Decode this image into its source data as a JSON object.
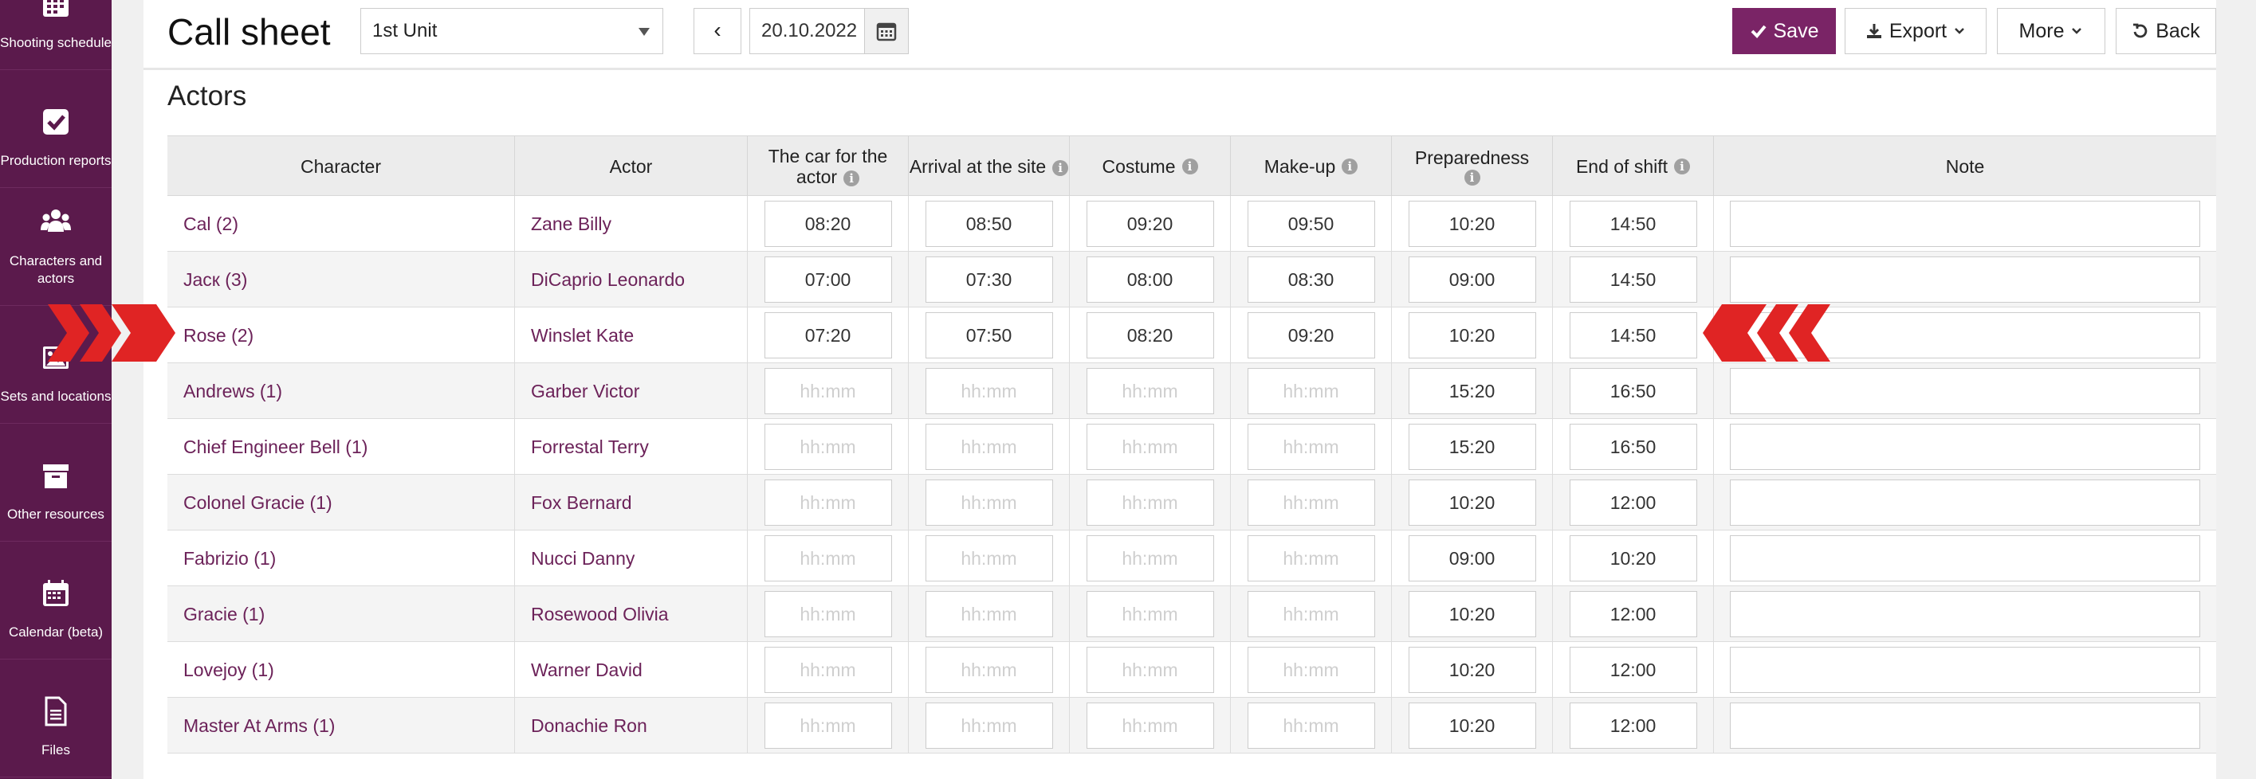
{
  "sidebar": {
    "items": [
      {
        "label": "Shooting schedule",
        "icon": "calendar-grid-icon"
      },
      {
        "label": "Production reports",
        "icon": "checkbox-icon"
      },
      {
        "label": "Characters and actors",
        "icon": "users-icon"
      },
      {
        "label": "Sets and locations",
        "icon": "image-icon"
      },
      {
        "label": "Other resources",
        "icon": "archive-box-icon"
      },
      {
        "label": "Calendar (beta)",
        "icon": "calendar-icon"
      },
      {
        "label": "Files",
        "icon": "file-icon"
      }
    ]
  },
  "header": {
    "title": "Call sheet",
    "unit_select": "1st Unit",
    "prev_label": "‹",
    "date": "20.10.2022",
    "save_label": "Save",
    "export_label": "Export",
    "more_label": "More",
    "back_label": "Back"
  },
  "section": {
    "title": "Actors"
  },
  "table": {
    "headers": {
      "character": "Character",
      "actor": "Actor",
      "car": "The car for the actor",
      "arrival": "Arrival at the site",
      "costume": "Costume",
      "makeup": "Make-up",
      "preparedness": "Preparedness",
      "end": "End of shift",
      "note": "Note"
    },
    "placeholder": "hh:mm",
    "rows": [
      {
        "character": "Cal (2)",
        "actor": "Zane Billy",
        "car": "08:20",
        "arrival": "08:50",
        "costume": "09:20",
        "makeup": "09:50",
        "preparedness": "10:20",
        "end": "14:50"
      },
      {
        "character": "Jacк (3)",
        "actor": "DiCaprio Leonardo",
        "car": "07:00",
        "arrival": "07:30",
        "costume": "08:00",
        "makeup": "08:30",
        "preparedness": "09:00",
        "end": "14:50"
      },
      {
        "character": "Rose (2)",
        "actor": "Winslet Kate",
        "car": "07:20",
        "arrival": "07:50",
        "costume": "08:20",
        "makeup": "09:20",
        "preparedness": "10:20",
        "end": "14:50"
      },
      {
        "character": "Andrews (1)",
        "actor": "Garber Victor",
        "car": "",
        "arrival": "",
        "costume": "",
        "makeup": "",
        "preparedness": "15:20",
        "end": "16:50"
      },
      {
        "character": "Chief Engineer Bell (1)",
        "actor": "Forrestal Terry",
        "car": "",
        "arrival": "",
        "costume": "",
        "makeup": "",
        "preparedness": "15:20",
        "end": "16:50"
      },
      {
        "character": "Colonel Gracie (1)",
        "actor": "Fox Bernard",
        "car": "",
        "arrival": "",
        "costume": "",
        "makeup": "",
        "preparedness": "10:20",
        "end": "12:00"
      },
      {
        "character": "Fabrizio (1)",
        "actor": "Nucci Danny",
        "car": "",
        "arrival": "",
        "costume": "",
        "makeup": "",
        "preparedness": "09:00",
        "end": "10:20"
      },
      {
        "character": "Gracie (1)",
        "actor": "Rosewood Olivia",
        "car": "",
        "arrival": "",
        "costume": "",
        "makeup": "",
        "preparedness": "10:20",
        "end": "12:00"
      },
      {
        "character": "Lovejoy (1)",
        "actor": "Warner David",
        "car": "",
        "arrival": "",
        "costume": "",
        "makeup": "",
        "preparedness": "10:20",
        "end": "12:00"
      },
      {
        "character": "Master At Arms (1)",
        "actor": "Donachie Ron",
        "car": "",
        "arrival": "",
        "costume": "",
        "makeup": "",
        "preparedness": "10:20",
        "end": "12:00"
      }
    ]
  },
  "colors": {
    "sidebar": "#5b1a4c",
    "accent": "#7a2466",
    "link": "#6c2259",
    "annotation": "#e02424"
  }
}
